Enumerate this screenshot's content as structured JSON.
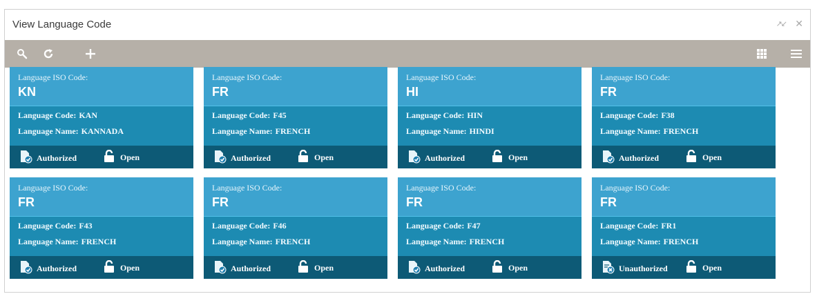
{
  "window": {
    "title": "View Language Code",
    "minimize_glyph": "↗↙",
    "close_glyph": "✕"
  },
  "toolbar": {
    "icons": [
      "search-icon",
      "refresh-icon",
      "add-icon",
      "grid-view-icon",
      "list-view-icon"
    ]
  },
  "labels": {
    "iso": "Language ISO Code:",
    "code": "Language Code:",
    "name": "Language Name:",
    "open": "Open"
  },
  "colors": {
    "toolbar_bg": "#b6b0a8",
    "card_head": "#3da3cf",
    "card_body": "#1d8bb2",
    "card_foot": "#0d5a76"
  },
  "cards": [
    {
      "iso": "KN",
      "code": "KAN",
      "name": "KANNADA",
      "status": "Authorized",
      "status_icon": "authorized-icon",
      "lock": "Open"
    },
    {
      "iso": "FR",
      "code": "F45",
      "name": "FRENCH",
      "status": "Authorized",
      "status_icon": "authorized-icon",
      "lock": "Open"
    },
    {
      "iso": "HI",
      "code": "HIN",
      "name": "HINDI",
      "status": "Authorized",
      "status_icon": "authorized-icon",
      "lock": "Open"
    },
    {
      "iso": "FR",
      "code": "F38",
      "name": "FRENCH",
      "status": "Authorized",
      "status_icon": "authorized-icon",
      "lock": "Open"
    },
    {
      "iso": "FR",
      "code": "F43",
      "name": "FRENCH",
      "status": "Authorized",
      "status_icon": "authorized-icon",
      "lock": "Open"
    },
    {
      "iso": "FR",
      "code": "F46",
      "name": "FRENCH",
      "status": "Authorized",
      "status_icon": "authorized-icon",
      "lock": "Open"
    },
    {
      "iso": "FR",
      "code": "F47",
      "name": "FRENCH",
      "status": "Authorized",
      "status_icon": "authorized-icon",
      "lock": "Open"
    },
    {
      "iso": "FR",
      "code": "FR1",
      "name": "FRENCH",
      "status": "Unauthorized",
      "status_icon": "unauthorized-icon",
      "lock": "Open"
    }
  ]
}
